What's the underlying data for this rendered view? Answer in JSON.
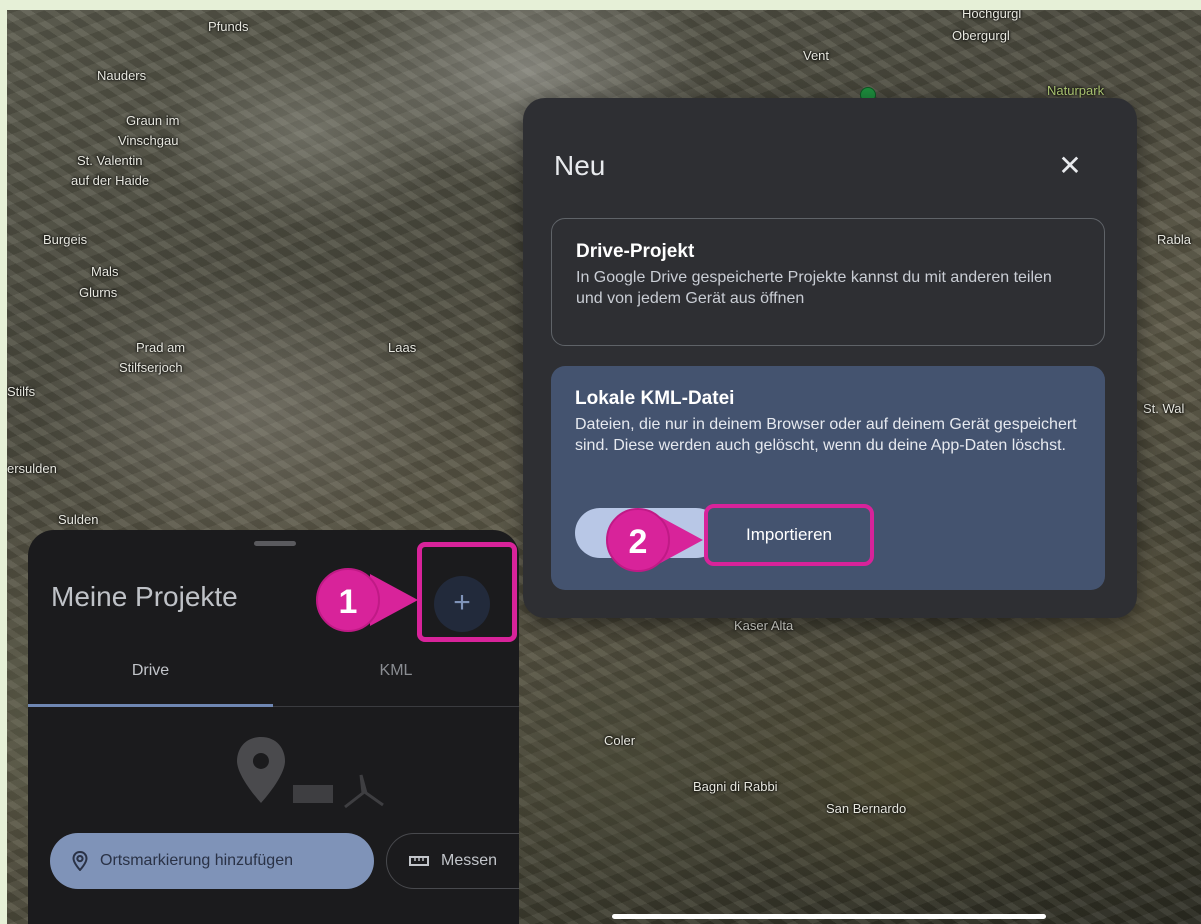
{
  "map": {
    "labels": [
      "Pfunds",
      "Nauders",
      "Graun im",
      "Vinschgau",
      "St. Valentin",
      "auf der Haide",
      "Burgeis",
      "Mals",
      "Glurns",
      "Prad am",
      "Stilfserjoch",
      "Laas",
      "Stilfs",
      "ersulden",
      "Sulden",
      "Vent",
      "Hochgurgl",
      "Obergurgl",
      "Naturpark",
      "Rabla",
      "St. Wal",
      "Kaser Alta",
      "Coler",
      "Bagni di Rabbi",
      "San Bernardo"
    ]
  },
  "dialog": {
    "title": "Neu",
    "close_icon": "close-icon",
    "drive_option": {
      "title": "Drive-Projekt",
      "description": "In Google Drive gespeicherte Projekte kannst du mit anderen teilen und von jedem Gerät aus öffnen"
    },
    "kml_option": {
      "title": "Lokale KML-Datei",
      "description": "Dateien, die nur in deinem Browser oder auf deinem Gerät gespeichert sind. Diese werden auch gelöscht, wenn du deine App-Daten löschst.",
      "import_label": "Importieren"
    }
  },
  "panel": {
    "title": "Meine Projekte",
    "add_icon": "plus-icon",
    "tabs": [
      "Drive",
      "KML"
    ],
    "active_tab": "Drive",
    "chips": {
      "place_label": "Ortsmarkierung hinzufügen",
      "measure_label": "Messen"
    }
  },
  "callouts": [
    "1",
    "2"
  ],
  "colors": {
    "highlight": "#d8239a",
    "accent": "#7f93b8",
    "dialog_bg": "#2e2f33",
    "panel_bg": "#1b1b1d",
    "selected_option_bg": "#44536f"
  }
}
